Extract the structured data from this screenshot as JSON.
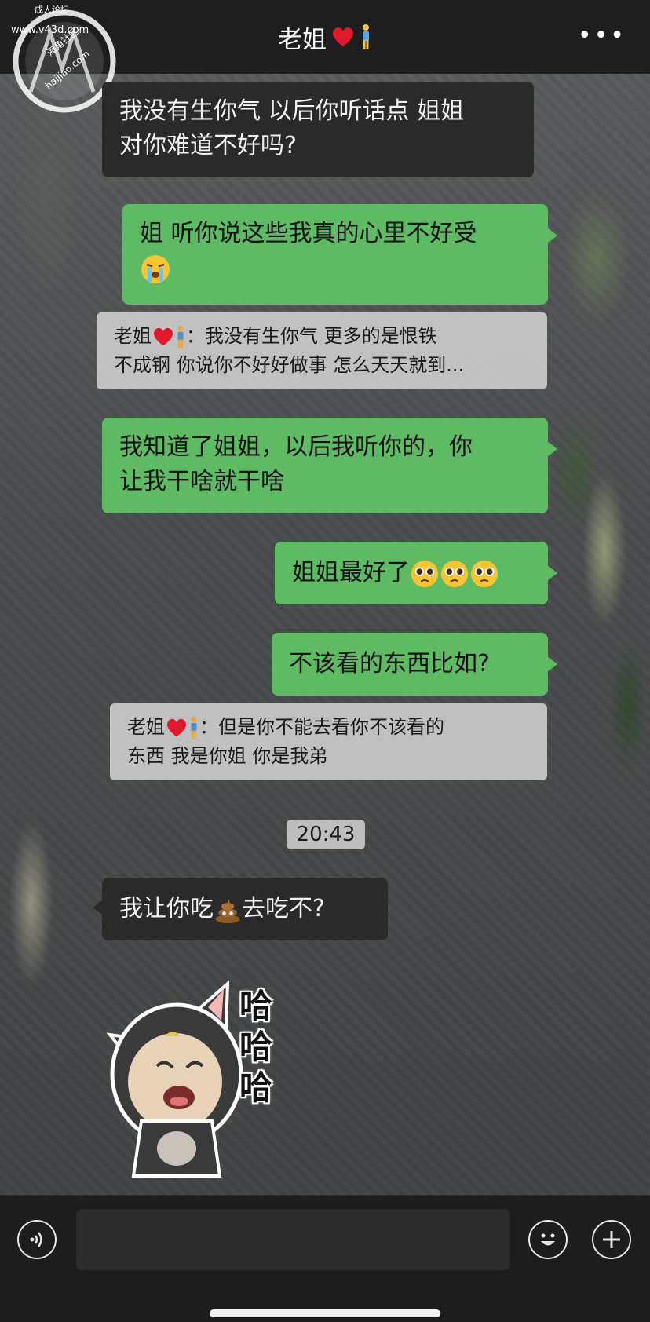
{
  "header": {
    "title": "老姐",
    "more": "•••"
  },
  "watermark": {
    "line1": "成人论坛",
    "line2": "www.v43d.com",
    "line3": "海角社区",
    "line4": "haijiao.com"
  },
  "messages": {
    "m1": {
      "line1": "我没有生你气 以后你听话点 姐姐",
      "line2": "对你难道不好吗?"
    },
    "m2": {
      "line1": "姐 听你说这些我真的心里不好受"
    },
    "m3": {
      "sender": "老姐",
      "line1_after": "：我没有生你气 更多的是恨铁",
      "line2": "不成钢 你说你不好好做事 怎么天天就到..."
    },
    "m4": {
      "line1": "我知道了姐姐，以后我听你的，你",
      "line2": "让我干啥就干啥"
    },
    "m5": {
      "text": "姐姐最好了"
    },
    "m6": {
      "text": "不该看的东西比如?"
    },
    "m7": {
      "sender": "老姐",
      "line1_after": "：但是你不能去看你不该看的",
      "line2": "东西 我是你姐 你是我弟"
    },
    "time": "20:43",
    "m8": {
      "before": "我让你吃",
      "after": "去吃不?"
    },
    "sticker": {
      "char1": "哈",
      "char2": "哈",
      "char3": "哈"
    }
  },
  "input": {
    "placeholder": ""
  }
}
